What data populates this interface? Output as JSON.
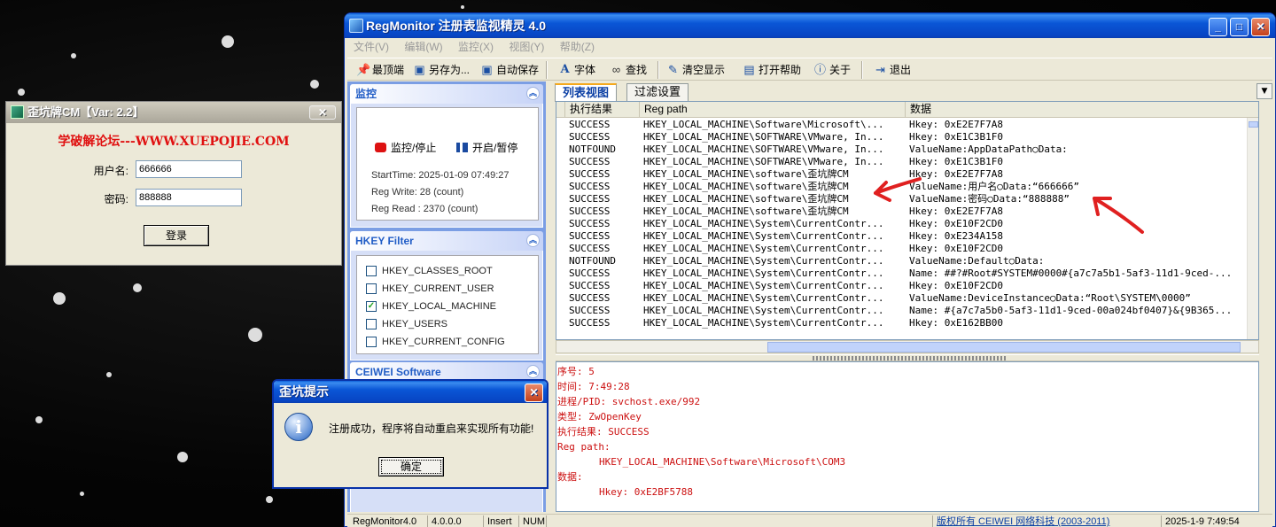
{
  "regmonitor": {
    "title": "RegMonitor 注册表监视精灵 4.0",
    "menu": [
      "文件(V)",
      "编辑(W)",
      "监控(X)",
      "视图(Y)",
      "帮助(Z)"
    ],
    "toolbar": {
      "topmost": "最顶端",
      "save_as": "另存为...",
      "auto_save": "自动保存",
      "font": "字体",
      "find": "查找",
      "clear": "清空显示",
      "help": "打开帮助",
      "about": "关于",
      "exit": "退出"
    },
    "monitor_panel": {
      "title": "监控",
      "start_stop": "监控/停止",
      "pause_resume": "开启/暂停",
      "start_time": "StartTime: 2025-01-09 07:49:27",
      "reg_write": "Reg Write: 28 (count)",
      "reg_read": "Reg Read : 2370 (count)"
    },
    "hkey_filter": {
      "title": "HKEY Filter",
      "items": [
        {
          "label": "HKEY_CLASSES_ROOT",
          "checked": false
        },
        {
          "label": "HKEY_CURRENT_USER",
          "checked": false
        },
        {
          "label": "HKEY_LOCAL_MACHINE",
          "checked": true
        },
        {
          "label": "HKEY_USERS",
          "checked": false
        },
        {
          "label": "HKEY_CURRENT_CONFIG",
          "checked": false
        }
      ]
    },
    "ceiwei_panel": {
      "title": "CEIWEI Software"
    },
    "tabs": [
      "列表视图",
      "过滤设置"
    ],
    "columns": [
      "执行结果",
      "Reg path",
      "数据"
    ],
    "rows": [
      [
        "SUCCESS",
        "HKEY_LOCAL_MACHINE\\Software\\Microsoft\\...",
        "Hkey: 0xE2E7F7A8"
      ],
      [
        "SUCCESS",
        "HKEY_LOCAL_MACHINE\\SOFTWARE\\VMware, In...",
        "Hkey: 0xE1C3B1F0"
      ],
      [
        "NOTFOUND",
        "HKEY_LOCAL_MACHINE\\SOFTWARE\\VMware, In...",
        "ValueName:AppDataPath○Data:"
      ],
      [
        "SUCCESS",
        "HKEY_LOCAL_MACHINE\\SOFTWARE\\VMware, In...",
        "Hkey: 0xE1C3B1F0"
      ],
      [
        "SUCCESS",
        "HKEY_LOCAL_MACHINE\\software\\歪坑牌CM",
        "Hkey: 0xE2E7F7A8"
      ],
      [
        "SUCCESS",
        "HKEY_LOCAL_MACHINE\\software\\歪坑牌CM",
        "ValueName:用户名○Data:“666666”"
      ],
      [
        "SUCCESS",
        "HKEY_LOCAL_MACHINE\\software\\歪坑牌CM",
        "ValueName:密码○Data:“888888”"
      ],
      [
        "SUCCESS",
        "HKEY_LOCAL_MACHINE\\software\\歪坑牌CM",
        "Hkey: 0xE2E7F7A8"
      ],
      [
        "SUCCESS",
        "HKEY_LOCAL_MACHINE\\System\\CurrentContr...",
        "Hkey: 0xE10F2CD0"
      ],
      [
        "SUCCESS",
        "HKEY_LOCAL_MACHINE\\System\\CurrentContr...",
        "Hkey: 0xE234A158"
      ],
      [
        "SUCCESS",
        "HKEY_LOCAL_MACHINE\\System\\CurrentContr...",
        "Hkey: 0xE10F2CD0"
      ],
      [
        "NOTFOUND",
        "HKEY_LOCAL_MACHINE\\System\\CurrentContr...",
        "ValueName:Default○Data:"
      ],
      [
        "SUCCESS",
        "HKEY_LOCAL_MACHINE\\System\\CurrentContr...",
        "Name: ##?#Root#SYSTEM#0000#{a7c7a5b1-5af3-11d1-9ced-..."
      ],
      [
        "SUCCESS",
        "HKEY_LOCAL_MACHINE\\System\\CurrentContr...",
        "Hkey: 0xE10F2CD0"
      ],
      [
        "SUCCESS",
        "HKEY_LOCAL_MACHINE\\System\\CurrentContr...",
        "ValueName:DeviceInstance○Data:“Root\\SYSTEM\\0000”"
      ],
      [
        "SUCCESS",
        "HKEY_LOCAL_MACHINE\\System\\CurrentContr...",
        "Name: #{a7c7a5b0-5af3-11d1-9ced-00a024bf0407}&{9B365..."
      ],
      [
        "SUCCESS",
        "HKEY_LOCAL_MACHINE\\System\\CurrentContr...",
        "Hkey: 0xE162BB00"
      ]
    ],
    "detail": {
      "seq": "序号: 5",
      "time": "时间: 7:49:28",
      "process": "进程/PID: svchost.exe/992",
      "type": "类型: ZwOpenKey",
      "result": "执行结果: SUCCESS",
      "regpath_label": "Reg path:",
      "regpath": "HKEY_LOCAL_MACHINE\\Software\\Microsoft\\COM3",
      "data_label": "数据:",
      "data": "Hkey: 0xE2BF5788"
    },
    "statusbar": {
      "app": "RegMonitor4.0",
      "version": "4.0.0.0",
      "mode": "Insert",
      "num": "NUM",
      "copyright": "版权所有 CEIWEI 网络科技 (2003-2011)",
      "datetime": "2025-1-9 7:49:54"
    }
  },
  "crackme": {
    "title": "歪坑牌CM【Var: 2.2】",
    "banner": "学破解论坛---WWW.XUEPOJIE.COM",
    "username_label": "用户名:",
    "username_value": "666666",
    "password_label": "密码:",
    "password_value": "888888",
    "login_button": "登录"
  },
  "dialog": {
    "title": "歪坑提示",
    "message": "注册成功，程序将自动重启来实现所有功能!",
    "ok_button": "确定"
  },
  "colors": {
    "title_blue": "#0a56d6",
    "detail_red": "#cc1111",
    "arrow_red": "#e02020",
    "banner_red": "#e01010"
  }
}
